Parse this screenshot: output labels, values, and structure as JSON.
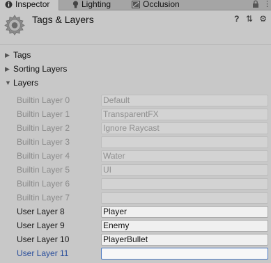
{
  "tabs": [
    {
      "label": "Inspector",
      "icon": "info-icon",
      "active": true
    },
    {
      "label": "Lighting",
      "icon": "bulb-icon",
      "active": false
    },
    {
      "label": "Occlusion",
      "icon": "occlusion-icon",
      "active": false
    }
  ],
  "tab_controls": {
    "lock": "🔒",
    "menu": "⋮"
  },
  "header": {
    "title": "Tags & Layers",
    "help": "?",
    "preset": "⇅",
    "settings": "⚙"
  },
  "sections": {
    "tags": {
      "label": "Tags",
      "arrow": "▶"
    },
    "sorting_layers": {
      "label": "Sorting Layers",
      "arrow": "▶"
    },
    "layers": {
      "label": "Layers",
      "arrow": "▼"
    }
  },
  "layers": [
    {
      "label": "Builtin Layer 0",
      "value": "Default"
    },
    {
      "label": "Builtin Layer 1",
      "value": "TransparentFX"
    },
    {
      "label": "Builtin Layer 2",
      "value": "Ignore Raycast"
    },
    {
      "label": "Builtin Layer 3",
      "value": ""
    },
    {
      "label": "Builtin Layer 4",
      "value": "Water"
    },
    {
      "label": "Builtin Layer 5",
      "value": "UI"
    },
    {
      "label": "Builtin Layer 6",
      "value": ""
    },
    {
      "label": "Builtin Layer 7",
      "value": ""
    },
    {
      "label": "User Layer 8",
      "value": "Player"
    },
    {
      "label": "User Layer 9",
      "value": "Enemy"
    },
    {
      "label": "User Layer 10",
      "value": "PlayerBullet"
    },
    {
      "label": "User Layer 11",
      "value": ""
    }
  ],
  "colors": {
    "panel": "#c8c8c8",
    "focus": "#4a78c2",
    "focus_label": "#2b4f9c"
  }
}
